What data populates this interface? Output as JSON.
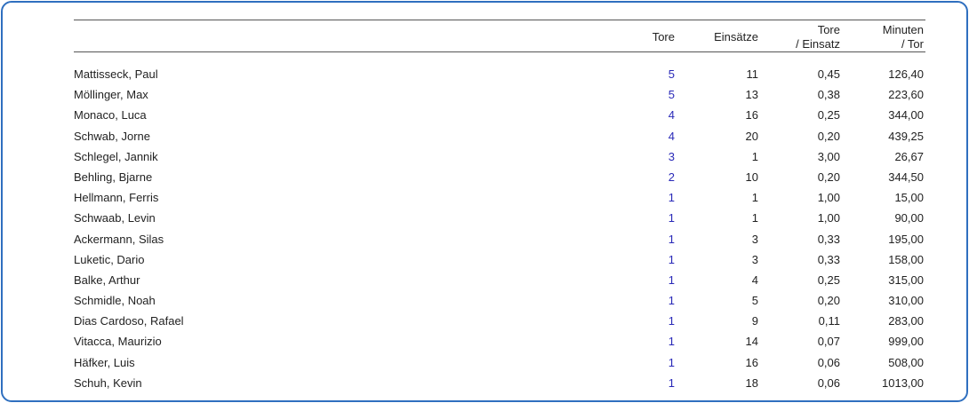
{
  "header": {
    "col_tore": "Tore",
    "col_einsaetze": "Einsätze",
    "col_tore_einsatz_line1": "Tore",
    "col_tore_einsatz_line2": "/ Einsatz",
    "col_minuten_tor_line1": "Minuten",
    "col_minuten_tor_line2": "/ Tor"
  },
  "rows": [
    {
      "name": "Mattisseck, Paul",
      "tore": "5",
      "einsaetze": "11",
      "tore_einsatz": "0,45",
      "minuten_tor": "126,40"
    },
    {
      "name": "Möllinger, Max",
      "tore": "5",
      "einsaetze": "13",
      "tore_einsatz": "0,38",
      "minuten_tor": "223,60"
    },
    {
      "name": "Monaco, Luca",
      "tore": "4",
      "einsaetze": "16",
      "tore_einsatz": "0,25",
      "minuten_tor": "344,00"
    },
    {
      "name": "Schwab, Jorne",
      "tore": "4",
      "einsaetze": "20",
      "tore_einsatz": "0,20",
      "minuten_tor": "439,25"
    },
    {
      "name": "Schlegel, Jannik",
      "tore": "3",
      "einsaetze": "1",
      "tore_einsatz": "3,00",
      "minuten_tor": "26,67"
    },
    {
      "name": "Behling, Bjarne",
      "tore": "2",
      "einsaetze": "10",
      "tore_einsatz": "0,20",
      "minuten_tor": "344,50"
    },
    {
      "name": "Hellmann, Ferris",
      "tore": "1",
      "einsaetze": "1",
      "tore_einsatz": "1,00",
      "minuten_tor": "15,00"
    },
    {
      "name": "Schwaab, Levin",
      "tore": "1",
      "einsaetze": "1",
      "tore_einsatz": "1,00",
      "minuten_tor": "90,00"
    },
    {
      "name": "Ackermann, Silas",
      "tore": "1",
      "einsaetze": "3",
      "tore_einsatz": "0,33",
      "minuten_tor": "195,00"
    },
    {
      "name": "Luketic, Dario",
      "tore": "1",
      "einsaetze": "3",
      "tore_einsatz": "0,33",
      "minuten_tor": "158,00"
    },
    {
      "name": "Balke, Arthur",
      "tore": "1",
      "einsaetze": "4",
      "tore_einsatz": "0,25",
      "minuten_tor": "315,00"
    },
    {
      "name": "Schmidle, Noah",
      "tore": "1",
      "einsaetze": "5",
      "tore_einsatz": "0,20",
      "minuten_tor": "310,00"
    },
    {
      "name": "Dias Cardoso, Rafael",
      "tore": "1",
      "einsaetze": "9",
      "tore_einsatz": "0,11",
      "minuten_tor": "283,00"
    },
    {
      "name": "Vitacca, Maurizio",
      "tore": "1",
      "einsaetze": "14",
      "tore_einsatz": "0,07",
      "minuten_tor": "999,00"
    },
    {
      "name": "Häfker, Luis",
      "tore": "1",
      "einsaetze": "16",
      "tore_einsatz": "0,06",
      "minuten_tor": "508,00"
    },
    {
      "name": "Schuh, Kevin",
      "tore": "1",
      "einsaetze": "18",
      "tore_einsatz": "0,06",
      "minuten_tor": "1013,00"
    }
  ],
  "colors": {
    "frame": "#2f6fbf",
    "tore_link": "#2929b8",
    "text": "#222222"
  }
}
